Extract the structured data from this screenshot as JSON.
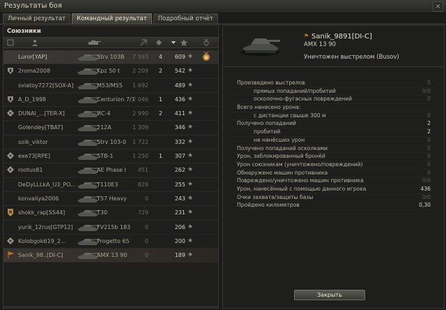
{
  "window": {
    "title": "Результаты боя",
    "close_glyph": "×"
  },
  "tabs": [
    {
      "label": "Личный результат",
      "active": false
    },
    {
      "label": "Командный результат",
      "active": true
    },
    {
      "label": "Подробный отчёт",
      "active": false
    }
  ],
  "team": {
    "title": "Союзники",
    "columns": [
      "squad-icon",
      "player-icon",
      "tank-icon",
      "damage-icon",
      "kills-icon",
      "xp-icon",
      "medal-icon"
    ],
    "players": [
      {
        "name": "Luror[YAP]",
        "tank": "Strv 103B",
        "damage": "7 593",
        "kills": "4",
        "xp": "609",
        "medal": true,
        "highlight": true,
        "emblem": ""
      },
      {
        "name": "2roma2008",
        "tank": "Kpz 50 t",
        "damage": "2 209",
        "kills": "2",
        "xp": "542",
        "emblem": "shield"
      },
      {
        "name": "sviatoy7272[SOX-A]",
        "tank": "M53/M55",
        "damage": "1 692",
        "kills": "",
        "xp": "489",
        "emblem": ""
      },
      {
        "name": "A_D_1998",
        "tank": "Centurion 7/1",
        "damage": "2 046",
        "kills": "1",
        "xp": "436",
        "emblem": "shield"
      },
      {
        "name": "DUNAI_...[TER-X]",
        "tank": "ИС-4",
        "damage": "2 990",
        "kills": "2",
        "xp": "411",
        "emblem": "clan"
      },
      {
        "name": "Golendey[TBAT]",
        "tank": "212A",
        "damage": "1 309",
        "kills": "",
        "xp": "346",
        "emblem": ""
      },
      {
        "name": "soik_viktor",
        "tank": "Strv 103-0",
        "damage": "1 722",
        "kills": "",
        "xp": "332",
        "emblem": ""
      },
      {
        "name": "exe73[RPE]",
        "tank": "STB-1",
        "damage": "1 250",
        "kills": "1",
        "xp": "307",
        "emblem": "clan"
      },
      {
        "name": "rootus81",
        "tank": "AE Phase I",
        "damage": "451",
        "kills": "",
        "xp": "262",
        "emblem": "clan"
      },
      {
        "name": "DeDyLLLkA_U3_PO...",
        "tank": "T110E3",
        "damage": "829",
        "kills": "",
        "xp": "255",
        "emblem": ""
      },
      {
        "name": "konvaliya2006",
        "tank": "T57 Heavy",
        "damage": "0",
        "kills": "",
        "xp": "243",
        "emblem": ""
      },
      {
        "name": "shokk_rap[SS44]",
        "tank": "T30",
        "damage": "729",
        "kills": "",
        "xp": "231",
        "emblem": "badge"
      },
      {
        "name": "yurik_12rus[GTP12]",
        "tank": "FV215b 183",
        "damage": "0",
        "kills": "",
        "xp": "206",
        "emblem": ""
      },
      {
        "name": "Kolobgok619_2...",
        "tank": "Progetto 65",
        "damage": "0",
        "kills": "",
        "xp": "200",
        "emblem": "clan"
      },
      {
        "name": "Sanik_98..[DI-C]",
        "tank": "AMX 13 90",
        "damage": "0",
        "kills": "",
        "xp": "189",
        "emblem": "flag",
        "self": true
      }
    ]
  },
  "detail": {
    "flag_glyph": "⚑",
    "player_name": "Sanik_9891[DI-C]",
    "tank_name": "AMX 13 90",
    "killed_by": "Уничтожен выстрелом (Busov)",
    "stats": [
      {
        "label": "Произведено выстрелов",
        "value": "0",
        "indent": false,
        "dim": false
      },
      {
        "label": "прямых попаданий/пробитий",
        "value": "0/0",
        "indent": true,
        "dim": false
      },
      {
        "label": "осколочно-фугасных повреждений",
        "value": "0",
        "indent": true,
        "dim": false
      },
      {
        "label": "Всего нанесено урона:",
        "value": "",
        "indent": false,
        "dim": false
      },
      {
        "label": "с дистанции свыше 300 м",
        "value": "0",
        "indent": true,
        "dim": false
      },
      {
        "label": "Получено попаданий",
        "value": "2",
        "indent": false,
        "dim": false,
        "bright": true
      },
      {
        "label": "пробитий",
        "value": "2",
        "indent": true,
        "dim": false,
        "bright": true
      },
      {
        "label": "не нанёсших урон",
        "value": "0",
        "indent": true,
        "dim": false
      },
      {
        "label": "Получено попаданий осколками",
        "value": "0",
        "indent": false,
        "dim": false
      },
      {
        "label": "Урон, заблокированный бронёй",
        "value": "0",
        "indent": false,
        "dim": false
      },
      {
        "label": "Урон союзникам (уничтожено/повреждений)",
        "value": "0",
        "indent": false,
        "dim": false
      },
      {
        "label": "Обнаружено машин противника",
        "value": "0",
        "indent": false,
        "dim": false
      },
      {
        "label": "Повреждено/уничтожено машин противника",
        "value": "0/0",
        "indent": false,
        "dim": false
      },
      {
        "label": "Урон, нанесённый с помощью данного игрока",
        "value": "436",
        "indent": false,
        "dim": false,
        "bright": true
      },
      {
        "label": "Очки захвата/защиты базы",
        "value": "0/0",
        "indent": false,
        "dim": false
      },
      {
        "label": "Пройдено километров",
        "value": "0,30",
        "indent": false,
        "dim": false,
        "bright": true
      }
    ],
    "close_label": "Закрыть"
  }
}
